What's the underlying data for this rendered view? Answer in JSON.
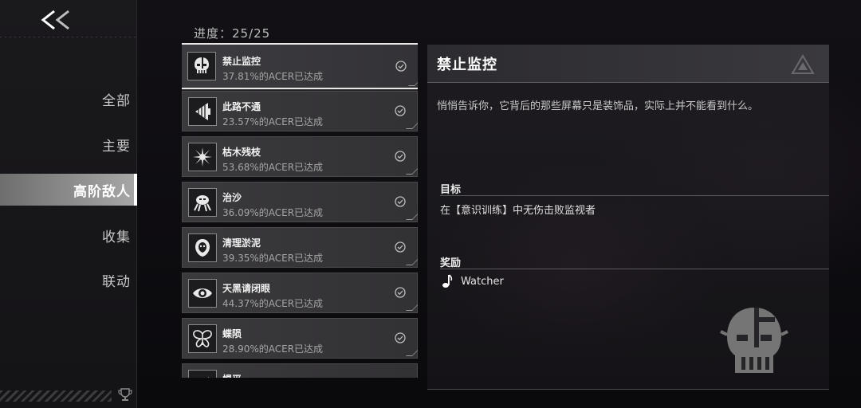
{
  "sidebar": {
    "items": [
      {
        "label": "全部"
      },
      {
        "label": "主要"
      },
      {
        "label": "高阶敌人"
      },
      {
        "label": "收集"
      },
      {
        "label": "联动"
      }
    ],
    "active_index": 2
  },
  "progress": {
    "text": "进度：25/25"
  },
  "achievements": [
    {
      "name": "禁止监控",
      "percent": "37.81%的ACER已达成",
      "icon": "skull-icon",
      "completed": true
    },
    {
      "name": "此路不通",
      "percent": "23.57%的ACER已达成",
      "icon": "drill-icon",
      "completed": true
    },
    {
      "name": "枯木残枝",
      "percent": "53.68%的ACER已达成",
      "icon": "thorn-icon",
      "completed": true
    },
    {
      "name": "治沙",
      "percent": "36.09%的ACER已达成",
      "icon": "crab-icon",
      "completed": true
    },
    {
      "name": "清理淤泥",
      "percent": "39.35%的ACER已达成",
      "icon": "mask-icon",
      "completed": true
    },
    {
      "name": "天黑请闭眼",
      "percent": "44.37%的ACER已达成",
      "icon": "eye-icon",
      "completed": true
    },
    {
      "name": "蝶陨",
      "percent": "28.90%的ACER已达成",
      "icon": "butterfly-icon",
      "completed": true
    },
    {
      "name": "惧平",
      "percent": "",
      "icon": "blade-icon",
      "completed": true
    }
  ],
  "detail": {
    "title": "禁止监控",
    "description": "悄悄告诉你，它背后的那些屏幕只是装饰品，实际上并不能看到什么。",
    "goal_label": "目标",
    "goal_text": "在【意识训练】中无伤击败监视者",
    "reward_label": "奖励",
    "reward_name": "Watcher",
    "reward_icon": "music-note-icon"
  },
  "colors": {
    "accent": "#ffffff",
    "active_nav_bg": "#a8a8a8",
    "card_bg": "#3a393c"
  }
}
